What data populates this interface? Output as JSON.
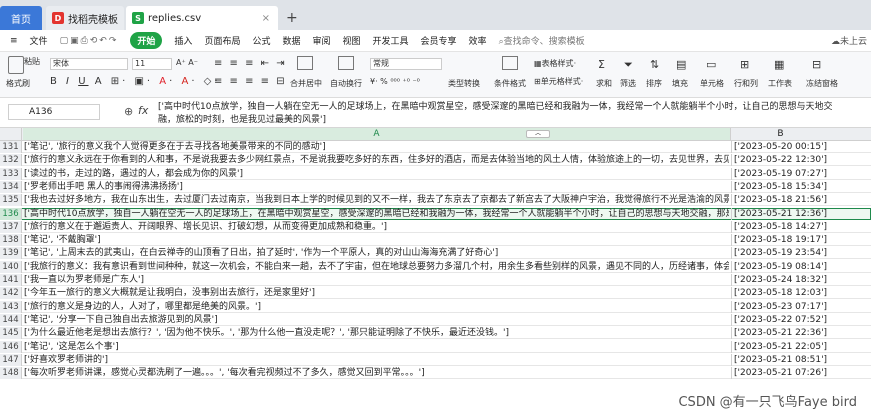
{
  "tabs": {
    "home": "首页",
    "template": "找稻壳模板",
    "file": "replies.csv",
    "add": "+"
  },
  "menu": [
    "文件",
    "开始",
    "插入",
    "页面布局",
    "公式",
    "数据",
    "审阅",
    "视图",
    "开发工具",
    "会员专享",
    "效率"
  ],
  "search_placeholder": "查找命令、搜索模板",
  "cloud": "未上云",
  "ribbon": {
    "format_painter": "格式刷",
    "paste": "粘贴",
    "font": "宋体",
    "size": "11",
    "merge": "合并居中",
    "wrap": "自动换行",
    "number_format": "常规",
    "convert": "类型转换",
    "cond": "条件格式",
    "table_style": "表格样式",
    "cell_style": "单元格样式",
    "sum": "求和",
    "filter": "筛选",
    "sort": "排序",
    "fill": "填充",
    "cell": "单元格",
    "rowcol": "行和列",
    "sheet": "工作表",
    "freeze": "冻结窗格"
  },
  "namebox": "A136",
  "fx": "fx",
  "formula": "['高中时代10点放学，独自一人躺在空无一人的足球场上，在黑暗中观赏星空，感受深邃的黑暗已经和我融为一体，我经常一个人就能躺半个小时，让自己的思想与天地交融，旅松的时刻，也是我见过最美的风景']",
  "col_a": "A",
  "col_b": "B",
  "rows": [
    {
      "n": "131",
      "a": "['笔记', '旅行的意义我个人觉得更多在于去寻找各地美景带来的不同的感动']",
      "b": "['2023-05-20 00:15']"
    },
    {
      "n": "132",
      "a": "['旅行的意义永远在于你看到的人和事，不是说我要去多少网红景点，不是说我要吃多好的东西，住多好的酒店，而是去体验当地的风土人情，体验旅途上的一切，去见世界，去见",
      "b": "['2023-05-22 12:30']"
    },
    {
      "n": "133",
      "a": "['读过的书，走过的路，遇过的人，都会成为你的风景']",
      "b": "['2023-05-19 07:27']"
    },
    {
      "n": "134",
      "a": "['罗老师出手吧 黑人的事闹得沸沸扬扬']",
      "b": "['2023-05-18 15:34']"
    },
    {
      "n": "135",
      "a": "['我也去过好多地方，我在山东出生，去过厦门去过南京，当我到日本上学的时候见到的又不一样，我去了东京去了京都去了新宫去了大阪神户宇治，我觉得旅行不光是浩渝的风景",
      "b": "['2023-05-18 21:56']"
    },
    {
      "n": "136",
      "a": "['高中时代10点放学，独自一人躺在空无一人的足球场上，在黑暗中观赏星空，感受深邃的黑暗已经和我融为一体，我经常一个人就能躺半个小时，让自己的思想与天地交融，那是",
      "b": "['2023-05-21 12:36']",
      "sel": true
    },
    {
      "n": "137",
      "a": "['旅行的意义在于邂逅贵人、开阔眼界、增长见识、打破幻想，从而变得更加成熟和稳重。']",
      "b": "['2023-05-18 14:27']"
    },
    {
      "n": "138",
      "a": "['笔记', '不戴胸罩']",
      "b": "['2023-05-18 19:17']"
    },
    {
      "n": "139",
      "a": "['笔记', '上周末去的武夷山，在白云禅寺的山顶看了日出，拍了延时', '作为一个平原人，真的对山山海海充满了好奇心']",
      "b": "['2023-05-19 23:54']"
    },
    {
      "n": "140",
      "a": "['我旅行的意义：我有意识看到世间种种，就这一次机会，不能白来一趟，去不了宇宙，但在地球总要努力多溜几个村，用余生多看些别样的风景，遇见不同的人，历经诸事，体会",
      "b": "['2023-05-19 08:14']"
    },
    {
      "n": "141",
      "a": "['我一直以为罗老师是广东人']",
      "b": "['2023-05-24 18:32']"
    },
    {
      "n": "142",
      "a": "['今年五一旅行的意义大概就是让我明白，没事别出去旅行，还是家里好']",
      "b": "['2023-05-18 12:03']"
    },
    {
      "n": "143",
      "a": "['旅行的意义是身边的人，人对了，哪里都是绝美的风景。']",
      "b": "['2023-05-23 07:17']"
    },
    {
      "n": "144",
      "a": "['笔记', '分享一下自己独自出去旅游见到的风景']",
      "b": "['2023-05-22 07:52']"
    },
    {
      "n": "145",
      "a": "['为什么最近他老是想出去旅行？', '因为他不快乐。', '那为什么他一直没走呢？', '那只能证明除了不快乐，最近还没钱。']",
      "b": "['2023-05-21 22:36']"
    },
    {
      "n": "146",
      "a": "['笔记', '这是怎么个事']",
      "b": "['2023-05-21 22:05']"
    },
    {
      "n": "147",
      "a": "['好喜欢罗老师讲的']",
      "b": "['2023-05-21 08:51']"
    },
    {
      "n": "148",
      "a": "['每次听罗老师讲课，感觉心灵都洗刷了一遍。。。', '每次看完视频过不了多久，感觉又回到平常。。。']",
      "b": "['2023-05-21 07:26']"
    }
  ],
  "watermark": "CSDN @有一只飞鸟Faye bird"
}
